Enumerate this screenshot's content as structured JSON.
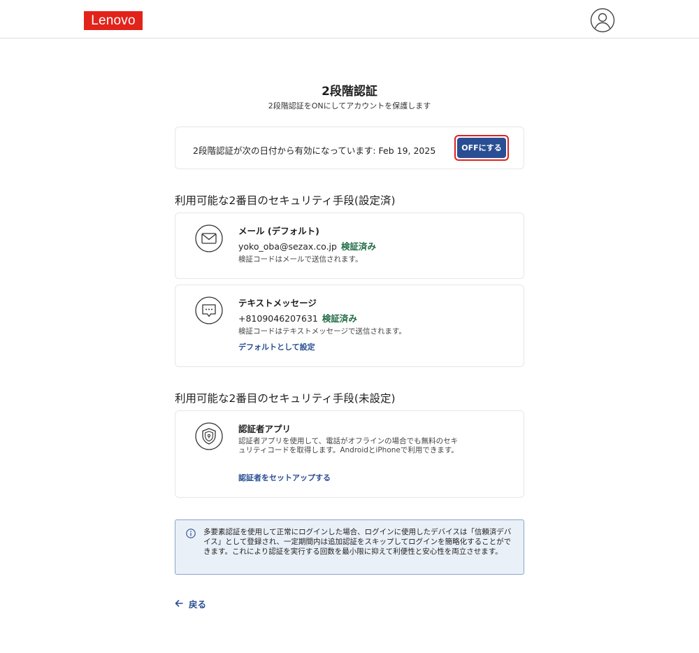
{
  "header": {
    "logo_text": "Lenovo",
    "brand_color": "#e2231a",
    "avatar_icon": "user-circle-icon"
  },
  "page": {
    "title": "2段階認証",
    "subtitle": "2段階認証をONにしてアカウントを保護します"
  },
  "status": {
    "text": "2段階認証が次の日付から有効になっています: Feb 19, 2025",
    "off_button_label": "OFFにする",
    "button_color": "#294e93"
  },
  "configured": {
    "heading": "利用可能な2番目のセキュリティ手段(設定済)",
    "methods": [
      {
        "icon": "envelope-icon",
        "title": "メール (デフォルト)",
        "contact": "yoko_oba@sezax.co.jp",
        "verified": "検証済み",
        "note": "検証コードはメールで送信されます。"
      },
      {
        "icon": "message-bubble-icon",
        "title": "テキストメッセージ",
        "contact": "+8109046207631",
        "verified": "検証済み",
        "note": "検証コードはテキストメッセージで送信されます。",
        "link": "デフォルトとして設定"
      }
    ]
  },
  "unconfigured": {
    "heading": "利用可能な2番目のセキュリティ手段(未設定)",
    "methods": [
      {
        "icon": "shield-lock-icon",
        "title": "認証者アプリ",
        "description": "認証者アプリを使用して、電話がオフラインの場合でも無料のセキュリティコードを取得します。AndroidとiPhoneで利用できます。",
        "link": "認証者をセットアップする"
      }
    ]
  },
  "info": {
    "icon": "info-icon",
    "text": "多要素認証を使用して正常にログインした場合、ログインに使用したデバイスは「信頼済デバイス」として登録され、一定期間内は追加認証をスキップしてログインを簡略化することができます。これにより認証を実行する回数を最小限に抑えて利便性と安心性を両立させます。"
  },
  "back": {
    "icon": "arrow-left-icon",
    "label": "戻る"
  },
  "colors": {
    "verified": "#1f6b43",
    "link": "#294e93",
    "highlight_outline": "#e02020",
    "info_background": "#eaf0f8"
  }
}
